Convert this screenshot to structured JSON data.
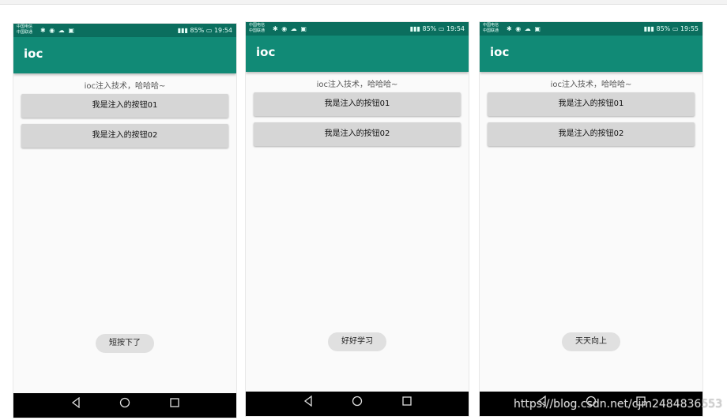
{
  "screens": [
    {
      "status": {
        "carrier_1": "中国电信",
        "carrier_2": "中国联通",
        "battery": "85%",
        "time": "19:54"
      },
      "app_title": "ioc",
      "subtitle": "ioc注入技术，哈哈哈~",
      "button_1": "我是注入的按钮01",
      "button_2": "我是注入的按钮02",
      "toast": "短按下了"
    },
    {
      "status": {
        "carrier_1": "中国电信",
        "carrier_2": "中国联通",
        "battery": "85%",
        "time": "19:54"
      },
      "app_title": "ioc",
      "subtitle": "ioc注入技术，哈哈哈~",
      "button_1": "我是注入的按钮01",
      "button_2": "我是注入的按钮02",
      "toast": "好好学习"
    },
    {
      "status": {
        "carrier_1": "中国电信",
        "carrier_2": "中国联通",
        "battery": "85%",
        "time": "19:55"
      },
      "app_title": "ioc",
      "subtitle": "ioc注入技术，哈哈哈~",
      "button_1": "我是注入的按钮01",
      "button_2": "我是注入的按钮02",
      "toast": "天天向上"
    }
  ],
  "nav_icons": [
    "back-icon",
    "home-icon",
    "recents-icon"
  ],
  "watermark": "https://blog.csdn.net/cjm2484836553",
  "colors": {
    "status_bar": "#0b6e5e",
    "app_bar": "#118a76",
    "button": "#d6d6d6",
    "nav_bar": "#000000"
  }
}
